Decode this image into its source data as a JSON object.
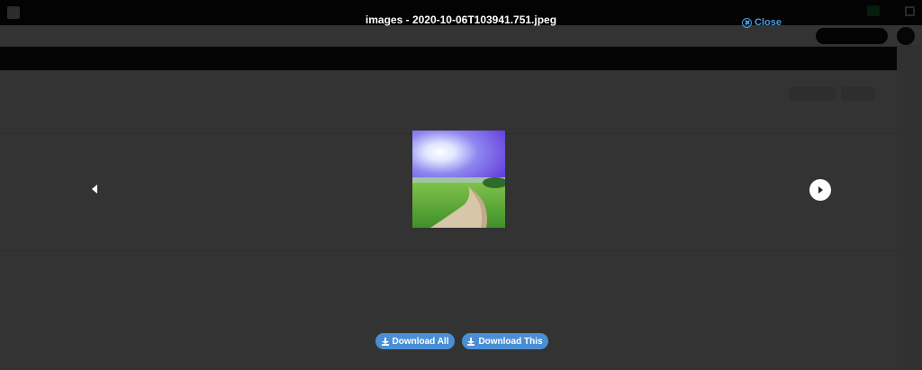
{
  "lightbox": {
    "title": "images - 2020-10-06T103941.751.jpeg",
    "close_label": "Close",
    "download_all_label": "Download All",
    "download_this_label": "Download This"
  },
  "colors": {
    "overlay": "#000000",
    "accent": "#4a8fd6",
    "close_link": "#4a9de0"
  },
  "icons": {
    "close": "close-circle-icon",
    "prev": "chevron-left-icon",
    "next": "chevron-right-icon",
    "download": "download-icon"
  }
}
